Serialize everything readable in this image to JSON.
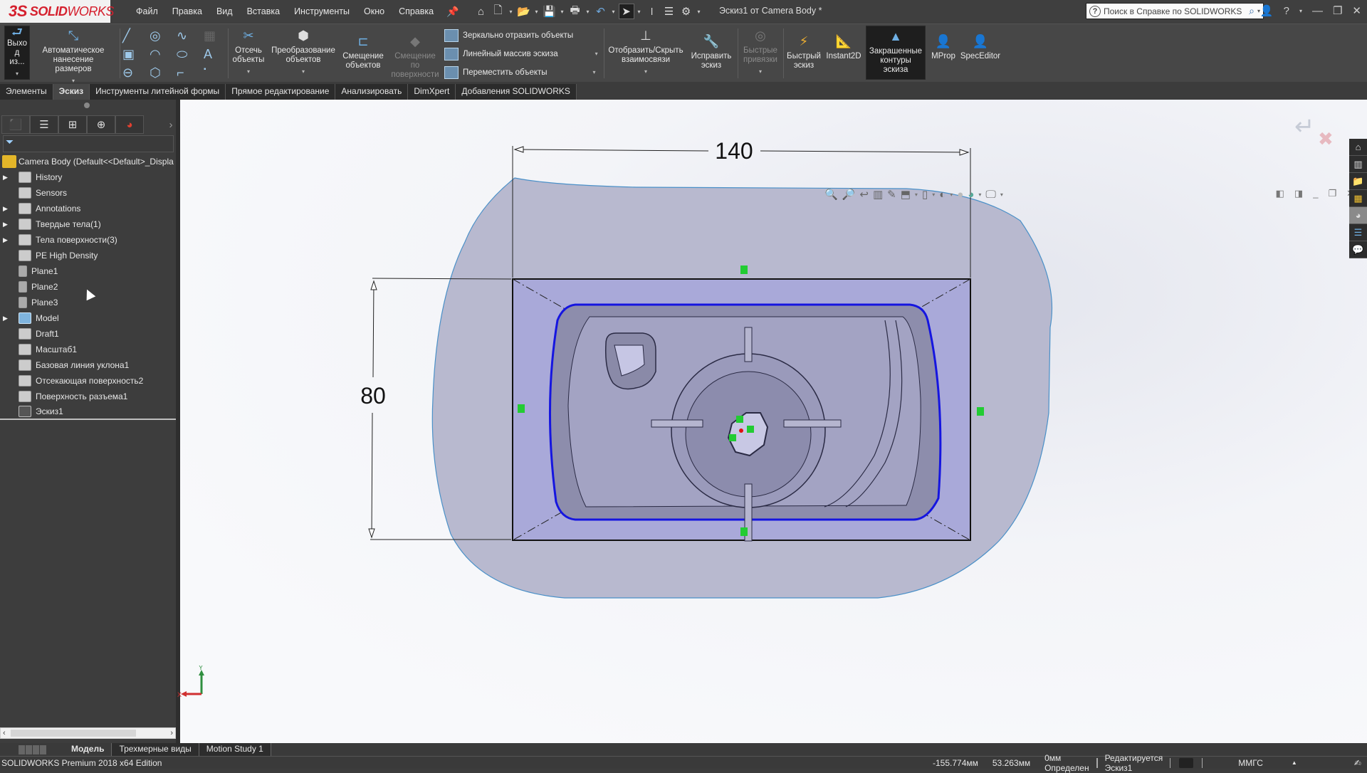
{
  "app": {
    "brand_prefix": "3S",
    "brand_bold": "SOLID",
    "brand_light": "WORKS",
    "document_title": "Эскиз1 от Camera Body *"
  },
  "menu": [
    "Файл",
    "Правка",
    "Вид",
    "Вставка",
    "Инструменты",
    "Окно",
    "Справка"
  ],
  "search": {
    "placeholder": "Поиск в Справке по SOLIDWORKS"
  },
  "ribbon": {
    "exit_sketch": "Выхо д из...",
    "smart_dimension": "Автоматическое нанесение размеров",
    "trim": "Отсечь объекты",
    "convert": "Преобразование объектов",
    "offset": "Смещение объектов",
    "offset_surface": "Смещение по поверхности",
    "mirror": "Зеркально отразить объекты",
    "linear_pattern": "Линейный массив эскиза",
    "move": "Переместить объекты",
    "display_relations": "Отобразить/Скрыть взаимосвязи",
    "repair": "Исправить эскиз",
    "quick_snaps": "Быстрые привязки",
    "rapid_sketch": "Быстрый эскиз",
    "instant2d": "Instant2D",
    "shaded_contours": "Закрашенные контуры эскиза",
    "mprop": "MProp",
    "speceditor": "SpecEditor"
  },
  "command_tabs": [
    "Элементы",
    "Эскиз",
    "Инструменты литейной формы",
    "Прямое редактирование",
    "Анализировать",
    "DimXpert",
    "Добавления SOLIDWORKS"
  ],
  "active_command_tab": "Эскиз",
  "feature_tree": {
    "root": "Camera Body  (Default<<Default>_Displa",
    "items": [
      {
        "label": "History",
        "expandable": true,
        "icon": "history-folder-icon"
      },
      {
        "label": "Sensors",
        "expandable": false,
        "icon": "sensors-folder-icon"
      },
      {
        "label": "Annotations",
        "expandable": true,
        "icon": "annotations-folder-icon"
      },
      {
        "label": "Твердые тела(1)",
        "expandable": true,
        "icon": "solid-bodies-folder-icon"
      },
      {
        "label": "Тела поверхности(3)",
        "expandable": true,
        "icon": "surface-bodies-folder-icon"
      },
      {
        "label": "PE High Density",
        "expandable": false,
        "icon": "material-icon"
      },
      {
        "label": "Plane1",
        "expandable": false,
        "icon": "plane-icon"
      },
      {
        "label": "Plane2",
        "expandable": false,
        "icon": "plane-icon"
      },
      {
        "label": "Plane3",
        "expandable": false,
        "icon": "plane-icon"
      },
      {
        "label": "Model",
        "expandable": true,
        "icon": "folder-icon"
      },
      {
        "label": "Draft1",
        "expandable": false,
        "icon": "draft-icon"
      },
      {
        "label": "Масштаб1",
        "expandable": false,
        "icon": "scale-icon"
      },
      {
        "label": "Базовая линия уклона1",
        "expandable": false,
        "icon": "parting-line-icon"
      },
      {
        "label": "Отсекающая поверхность2",
        "expandable": false,
        "icon": "shut-off-surface-icon"
      },
      {
        "label": "Поверхность разъема1",
        "expandable": false,
        "icon": "parting-surface-icon"
      },
      {
        "label": "Эскиз1",
        "expandable": false,
        "icon": "sketch-icon"
      }
    ]
  },
  "viewport": {
    "dimension_horizontal": "140",
    "dimension_vertical": "80",
    "triad_x": "X",
    "triad_y": "Y",
    "colors": {
      "sketch_rect_fill": "#a9a9d9",
      "surface_fill": "#b8b9cf",
      "contour_blue": "#1515e0",
      "relation_green": "#22cc33"
    }
  },
  "bottom_tabs": [
    "Модель",
    "Трехмерные виды",
    "Motion Study 1"
  ],
  "active_bottom_tab": "Модель",
  "status": {
    "edition": "SOLIDWORKS Premium 2018 x64 Edition",
    "x": "-155.774мм",
    "y": "53.263мм",
    "z_state": "0мм Определен",
    "editing": "Редактируется Эскиз1",
    "units": "ММГС"
  }
}
